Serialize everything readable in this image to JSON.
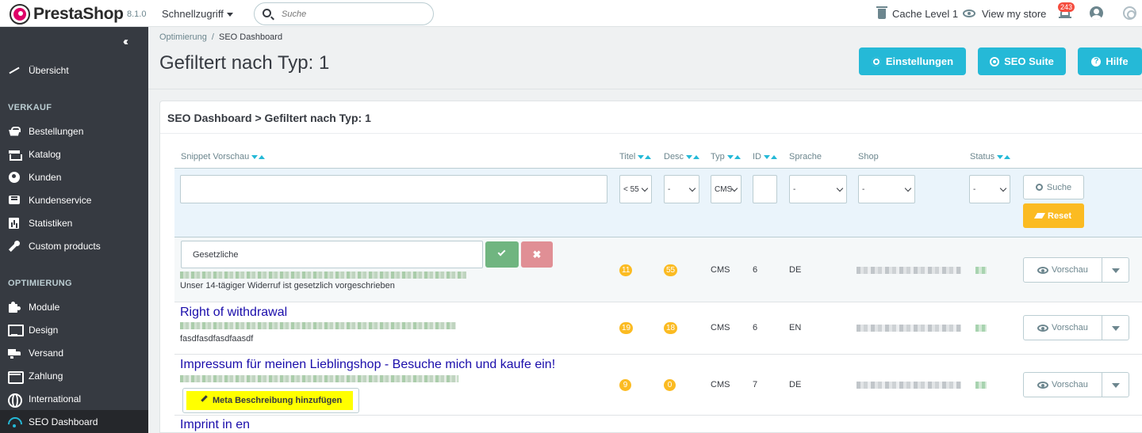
{
  "header": {
    "brand": "PrestaShop",
    "version": "8.1.0",
    "quick_access": "Schnellzugriff",
    "search_placeholder": "Suche",
    "cache": "Cache Level 1",
    "view_store": "View my store",
    "notifications": "243"
  },
  "sidebar": {
    "overview": "Übersicht",
    "sections": [
      {
        "title": "VERKAUF",
        "items": [
          "Bestellungen",
          "Katalog",
          "Kunden",
          "Kundenservice",
          "Statistiken",
          "Custom products"
        ]
      },
      {
        "title": "OPTIMIERUNG",
        "items": [
          "Module",
          "Design",
          "Versand",
          "Zahlung",
          "International",
          "SEO Dashboard"
        ]
      }
    ]
  },
  "page": {
    "breadcrumb": [
      "Optimierung",
      "SEO Dashboard"
    ],
    "breadcrumb_sep": "/",
    "title": "Gefiltert nach Typ: 1",
    "buttons": [
      "Einstellungen",
      "SEO Suite",
      "Hilfe"
    ]
  },
  "panel": {
    "title": "SEO Dashboard > Gefiltert nach Typ: 1",
    "columns": [
      "Snippet Vorschau",
      "Titel",
      "Desc",
      "Typ",
      "ID",
      "Sprache",
      "Shop",
      "Status"
    ],
    "filters": {
      "snippet": "",
      "titel": "< 55",
      "desc": "-",
      "typ": "CMS",
      "id": "",
      "sprache": "-",
      "shop": "-",
      "status": "-",
      "search_label": "Suche",
      "reset_label": "Reset"
    },
    "edit_value": "Gesetzliche",
    "cancel_glyph": "✖",
    "preview_label": "Vorschau",
    "add_meta_label": "Meta Beschreibung hinzufügen",
    "rows": [
      {
        "title": "",
        "desc": "Unser 14-tägiger Widerruf ist gesetzlich vorgeschrieben",
        "titel": "11",
        "desc_len": "55",
        "typ": "CMS",
        "id": "6",
        "lang": "DE"
      },
      {
        "title": "Right of withdrawal",
        "desc": "fasdfasdfasdfaasdf",
        "titel": "19",
        "desc_len": "18",
        "typ": "CMS",
        "id": "6",
        "lang": "EN"
      },
      {
        "title": "Impressum für meinen Lieblingshop - Besuche mich und kaufe ein!",
        "desc": "",
        "titel": "9",
        "desc_len": "0",
        "typ": "CMS",
        "id": "7",
        "lang": "DE"
      },
      {
        "title": "Imprint in en",
        "desc": "",
        "titel": "",
        "desc_len": "",
        "typ": "",
        "id": "",
        "lang": ""
      }
    ]
  },
  "colors": {
    "accent": "#25b9d7",
    "warning": "#fbbb22",
    "success": "#70b580",
    "danger": "#e08f95",
    "sidebar": "#363a41",
    "highlight": "#ffff00"
  }
}
